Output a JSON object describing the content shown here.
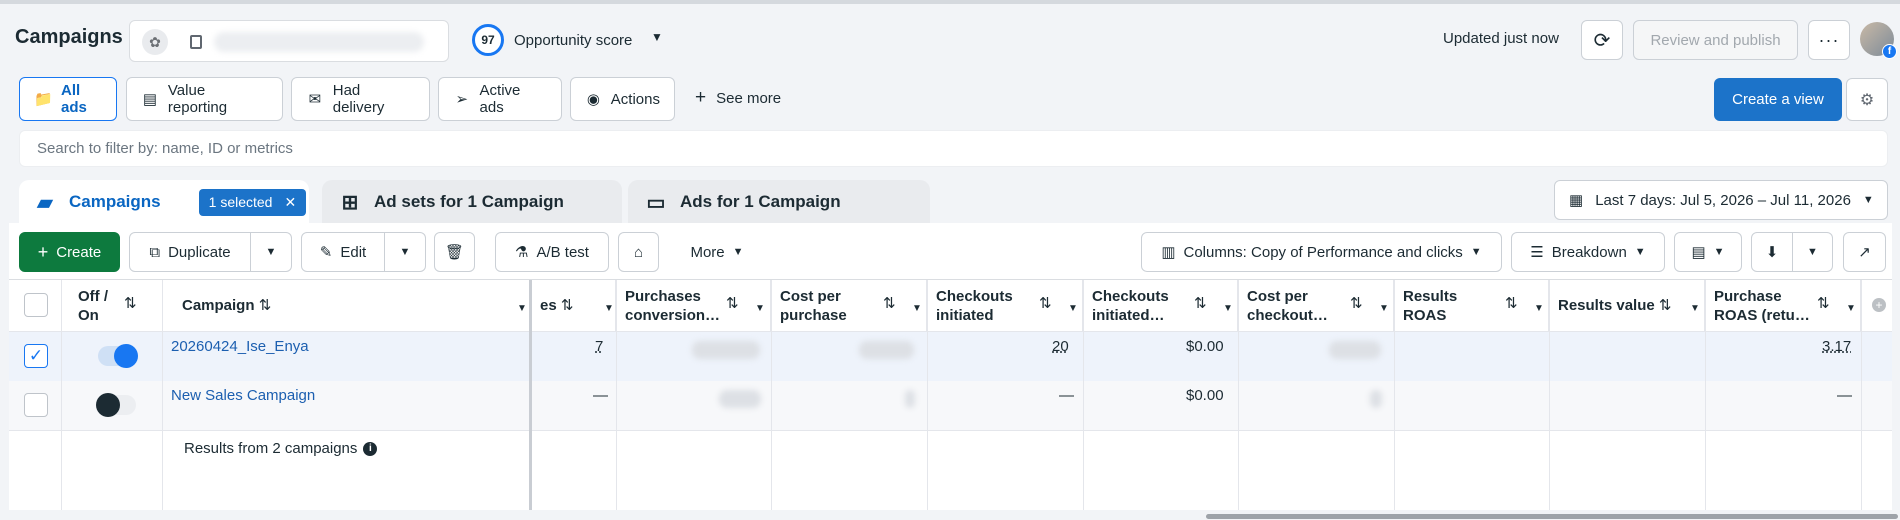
{
  "header": {
    "title": "Campaigns",
    "opportunity_score": "97",
    "opportunity_label": "Opportunity score",
    "updated_text": "Updated just now",
    "review_publish_label": "Review and publish",
    "more_label": "···"
  },
  "filters": {
    "chips": [
      {
        "label": "All ads",
        "icon": "folder-icon",
        "active": true
      },
      {
        "label": "Value reporting",
        "icon": "report-icon",
        "active": false
      },
      {
        "label": "Had delivery",
        "icon": "envelope-icon",
        "active": false
      },
      {
        "label": "Active ads",
        "icon": "send-icon",
        "active": false
      },
      {
        "label": "Actions",
        "icon": "cursor-icon",
        "active": false
      }
    ],
    "see_more_label": "See more",
    "create_view_label": "Create a view"
  },
  "search": {
    "placeholder": "Search to filter by: name, ID or metrics"
  },
  "tabs": {
    "campaigns_label": "Campaigns",
    "selected_badge": "1 selected",
    "adsets_label": "Ad sets for 1 Campaign",
    "ads_label": "Ads for 1 Campaign"
  },
  "date_range": {
    "label": "Last 7 days: Jul 5, 2026 – Jul 11, 2026"
  },
  "toolbar": {
    "create_label": "Create",
    "duplicate_label": "Duplicate",
    "edit_label": "Edit",
    "ab_test_label": "A/B test",
    "more_label": "More",
    "columns_label": "Columns: Copy of Performance and clicks",
    "breakdown_label": "Breakdown"
  },
  "table": {
    "headers": {
      "off_on": "Off / On",
      "campaign": "Campaign",
      "purchases_partial": "es",
      "purchases_conversion": "Purchases conversion…",
      "cost_per_purchase": "Cost per purchase",
      "checkouts_initiated": "Checkouts initiated",
      "checkouts_initiated_value": "Checkouts initiated…",
      "cost_per_checkout": "Cost per checkout…",
      "results_roas": "Results ROAS",
      "results_value": "Results value",
      "purchase_roas": "Purchase ROAS (retu…"
    },
    "rows": [
      {
        "selected": true,
        "on": true,
        "campaign": "20260424_Ise_Enya",
        "purchases": "7",
        "checkouts_initiated": "20",
        "checkouts_value": "$0.00",
        "purchase_roas": "3.17"
      },
      {
        "selected": false,
        "on": false,
        "campaign": "New Sales Campaign",
        "purchases": "—",
        "checkouts_initiated": "—",
        "checkouts_value": "$0.00",
        "purchase_roas": "—"
      }
    ],
    "results_summary": "Results from 2 campaigns"
  }
}
